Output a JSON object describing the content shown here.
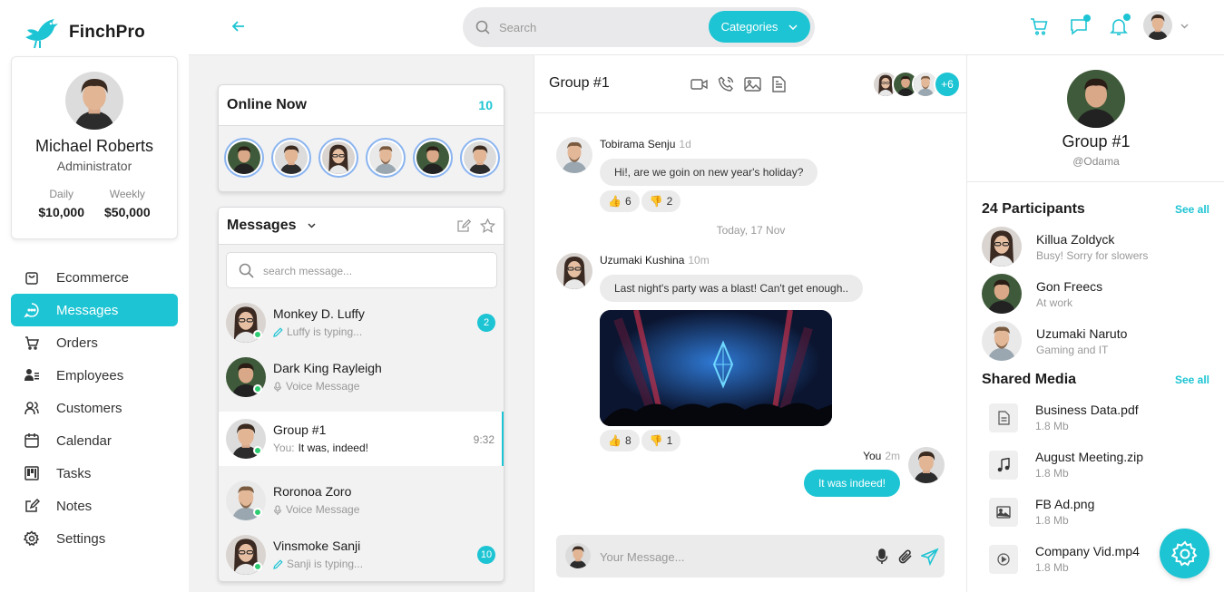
{
  "brand": {
    "name": "FinchPro",
    "accent": "#1dc4d3"
  },
  "profile": {
    "name": "Michael Roberts",
    "role": "Administrator",
    "stats": [
      {
        "label": "Daily",
        "value": "$10,000"
      },
      {
        "label": "Weekly",
        "value": "$50,000"
      }
    ]
  },
  "nav": [
    {
      "label": "Ecommerce",
      "icon": "bag-icon"
    },
    {
      "label": "Messages",
      "icon": "chat-icon",
      "active": true
    },
    {
      "label": "Orders",
      "icon": "cart-icon"
    },
    {
      "label": "Employees",
      "icon": "employees-icon"
    },
    {
      "label": "Customers",
      "icon": "customers-icon"
    },
    {
      "label": "Calendar",
      "icon": "calendar-icon"
    },
    {
      "label": "Tasks",
      "icon": "tasks-icon"
    },
    {
      "label": "Notes",
      "icon": "notes-icon"
    },
    {
      "label": "Settings",
      "icon": "settings-icon"
    }
  ],
  "header": {
    "search_placeholder": "Search",
    "categories_label": "Categories"
  },
  "online": {
    "title": "Online Now",
    "count": "10"
  },
  "messages": {
    "title": "Messages",
    "search_placeholder": "search message...",
    "conversations": [
      {
        "name": "Monkey D. Luffy",
        "sub": "Luffy is typing...",
        "badge": "2"
      },
      {
        "name": "Dark King Rayleigh",
        "sub": "Voice Message"
      },
      {
        "name": "Group #1",
        "sub_prefix": "You:",
        "sub": "It was, indeed!",
        "time": "9:32"
      },
      {
        "name": "Roronoa Zoro",
        "sub": "Voice Message"
      },
      {
        "name": "Vinsmoke Sanji",
        "sub": "Sanji is typing...",
        "badge": "10"
      }
    ]
  },
  "chat": {
    "title": "Group #1",
    "members_more": "+6",
    "messages": [
      {
        "sender": "Tobirama Senju",
        "time": "1d",
        "text": "Hi!, are we goin on new year's holiday?",
        "likes": "6",
        "dislikes": "2"
      },
      {
        "sender": "Uzumaki Kushina",
        "time": "10m",
        "text": "Last night's party was a blast! Can't get enough..",
        "likes": "8",
        "dislikes": "1"
      },
      {
        "sender": "You",
        "time": "2m",
        "text": "It was indeed!"
      }
    ],
    "date_separator": "Today, 17 Nov",
    "composer_placeholder": "Your Message..."
  },
  "group": {
    "name": "Group #1",
    "handle": "@Odama",
    "participants_title": "24 Participants",
    "see_all": "See all",
    "participants": [
      {
        "name": "Killua Zoldyck",
        "status": "Busy! Sorry for slowers"
      },
      {
        "name": "Gon Freecs",
        "status": "At work"
      },
      {
        "name": "Uzumaki Naruto",
        "status": "Gaming and IT"
      }
    ],
    "media_title": "Shared Media",
    "media": [
      {
        "name": "Business Data.pdf",
        "size": "1.8 Mb",
        "icon": "document-icon"
      },
      {
        "name": "August Meeting.zip",
        "size": "1.8 Mb",
        "icon": "music-icon"
      },
      {
        "name": "FB Ad.png",
        "size": "1.8 Mb",
        "icon": "image-icon"
      },
      {
        "name": "Company Vid.mp4",
        "size": "1.8 Mb",
        "icon": "video-icon"
      }
    ]
  }
}
